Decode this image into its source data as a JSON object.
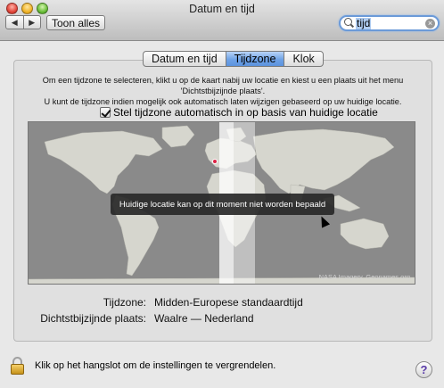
{
  "window": {
    "title": "Datum en tijd"
  },
  "toolbar": {
    "back_icon": "◀",
    "forward_icon": "▶",
    "show_all": "Toon alles"
  },
  "search": {
    "value": "tijd"
  },
  "tabs": [
    {
      "label": "Datum en tijd",
      "active": false
    },
    {
      "label": "Tijdzone",
      "active": true
    },
    {
      "label": "Klok",
      "active": false
    }
  ],
  "info": {
    "line1": "Om een tijdzone te selecteren, klikt u op de kaart nabij uw locatie en kiest u een plaats uit het menu",
    "line2": "'Dichtstbijzijnde plaats'.",
    "line3": "U kunt de tijdzone indien mogelijk ook automatisch laten wijzigen gebaseerd op uw huidige locatie."
  },
  "auto": {
    "label": "Stel tijdzone automatisch in op basis van huidige locatie",
    "checked": true
  },
  "map": {
    "tooltip": "Huidige locatie kan op dit moment niet worden bepaald",
    "credit": "NASA Imagery, Geonames.org"
  },
  "timezone": {
    "label": "Tijdzone:",
    "value": "Midden-Europese standaardtijd"
  },
  "city": {
    "label": "Dichtstbijzijnde plaats:",
    "value": "Waalre — Nederland"
  },
  "lock": {
    "text": "Klik op het hangslot om de instellingen te vergrendelen."
  },
  "help": {
    "label": "?"
  },
  "colors": {
    "accent": "#6ea2e6",
    "map_ocean": "#8a8a8a",
    "land": "#d9d9d2"
  }
}
